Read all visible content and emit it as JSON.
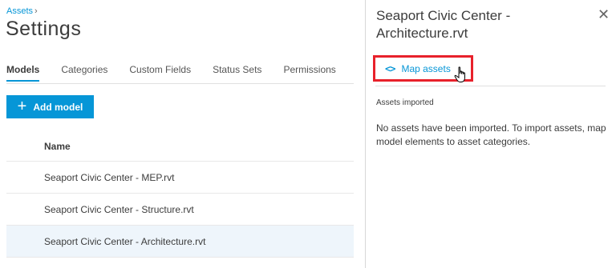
{
  "breadcrumb": {
    "label": "Assets"
  },
  "page": {
    "title": "Settings"
  },
  "tabs": [
    {
      "label": "Models",
      "active": true
    },
    {
      "label": "Categories",
      "active": false
    },
    {
      "label": "Custom Fields",
      "active": false
    },
    {
      "label": "Status Sets",
      "active": false
    },
    {
      "label": "Permissions",
      "active": false
    }
  ],
  "toolbar": {
    "add_model_label": "Add model"
  },
  "table": {
    "column_header": "Name",
    "rows": [
      "Seaport Civic Center - MEP.rvt",
      "Seaport Civic Center - Structure.rvt",
      "Seaport Civic Center - Architecture.rvt"
    ]
  },
  "panel": {
    "title": "Seaport Civic Center - Architecture.rvt",
    "map_assets_label": "Map assets",
    "section_label": "Assets imported",
    "empty_message": "No assets have been imported. To import assets, map model elements to asset categories."
  },
  "colors": {
    "accent": "#0696d7",
    "highlight_outline": "#e8212b",
    "selected_row": "#eef5fb"
  },
  "icons": [
    "chevron-right-icon",
    "plus-icon",
    "close-icon",
    "code-icon",
    "hand-cursor-icon"
  ]
}
